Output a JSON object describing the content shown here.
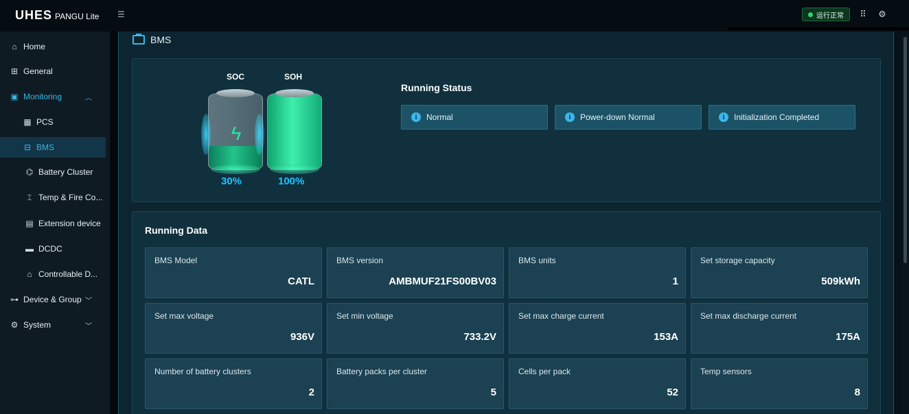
{
  "app": {
    "logo_main": "UHES",
    "logo_sub": "PANGU Lite",
    "status_text": "运行正常",
    "accent_color": "#38b6e8",
    "status_color": "#2bd66b"
  },
  "topbar": {
    "icons": [
      "fullscreen-icon",
      "settings-icon"
    ]
  },
  "sidebar": {
    "items": [
      {
        "label": "Home",
        "icon": "home-icon"
      },
      {
        "label": "General",
        "icon": "grid-icon"
      },
      {
        "label": "Monitoring",
        "icon": "monitor-icon"
      },
      {
        "label": "PCS",
        "icon": "pcs-icon"
      },
      {
        "label": "BMS",
        "icon": "bms-icon"
      },
      {
        "label": "Battery Cluster",
        "icon": "battery-cluster-icon"
      },
      {
        "label": "Temp & Fire Co...",
        "icon": "thermometer-icon"
      },
      {
        "label": "Extension device",
        "icon": "extension-icon"
      },
      {
        "label": "DCDC",
        "icon": "dcdc-icon"
      },
      {
        "label": "Controllable D...",
        "icon": "controllable-icon"
      },
      {
        "label": "Device & Group",
        "icon": "device-group-icon"
      },
      {
        "label": "System",
        "icon": "system-icon"
      }
    ]
  },
  "page": {
    "title": "BMS"
  },
  "gauges": {
    "soc_label": "SOC",
    "soh_label": "SOH",
    "soc_value": "30%",
    "soh_value": "100%",
    "soc_fraction": 0.3,
    "soh_fraction": 1.0
  },
  "running_status": {
    "title": "Running Status",
    "items": [
      "Normal",
      "Power-down Normal",
      "Initialization Completed"
    ]
  },
  "running_data": {
    "title": "Running Data",
    "cards": [
      {
        "label": "BMS Model",
        "value": "CATL"
      },
      {
        "label": "BMS version",
        "value": "AMBMUF21FS00BV03"
      },
      {
        "label": "BMS units",
        "value": "1"
      },
      {
        "label": "Set storage capacity",
        "value": "509kWh"
      },
      {
        "label": "Set max voltage",
        "value": "936V"
      },
      {
        "label": "Set min voltage",
        "value": "733.2V"
      },
      {
        "label": "Set max charge current",
        "value": "153A"
      },
      {
        "label": "Set max discharge current",
        "value": "175A"
      },
      {
        "label": "Number of battery clusters",
        "value": "2"
      },
      {
        "label": "Battery packs per cluster",
        "value": "5"
      },
      {
        "label": "Cells per pack",
        "value": "52"
      },
      {
        "label": "Temp sensors",
        "value": "8"
      }
    ]
  }
}
